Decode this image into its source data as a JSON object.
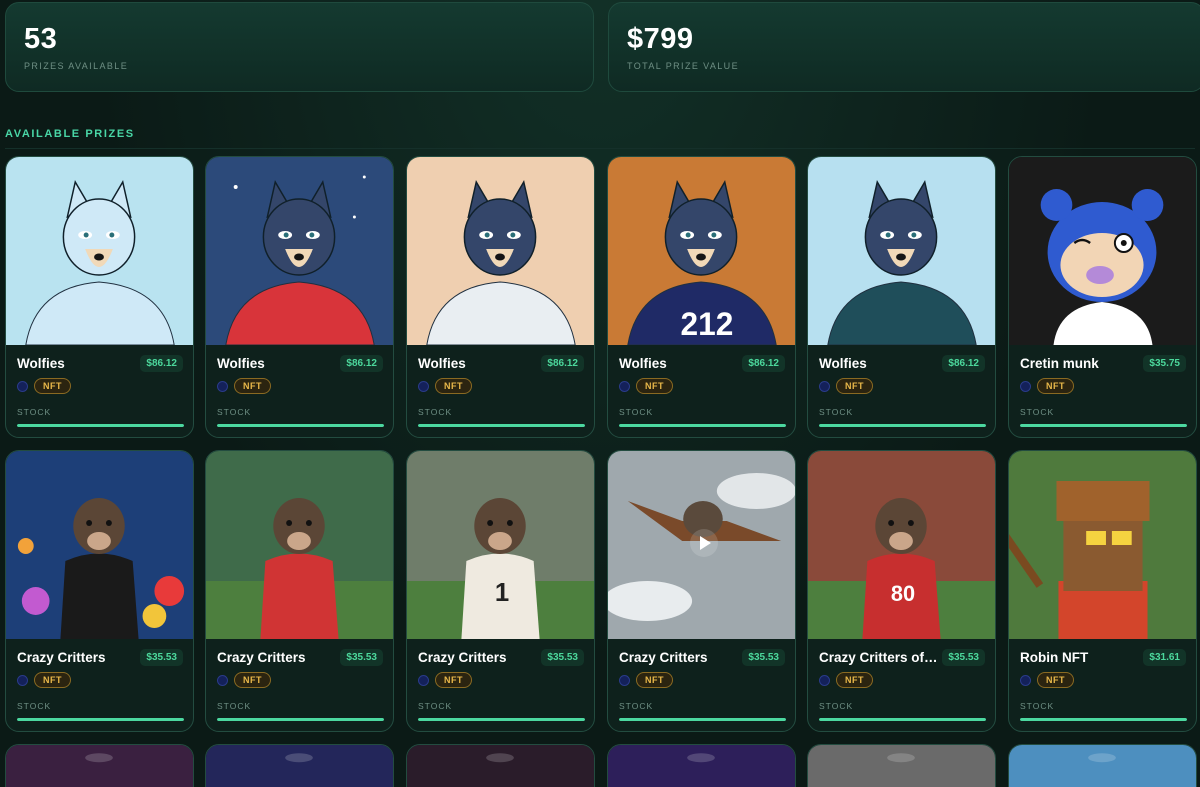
{
  "stats": [
    {
      "value": "53",
      "label": "PRIZES AVAILABLE"
    },
    {
      "value": "$799",
      "label": "TOTAL PRIZE VALUE"
    }
  ],
  "section_title": "AVAILABLE PRIZES",
  "stock_label": "STOCK",
  "badge_label": "NFT",
  "prizes": [
    {
      "name": "Wolfies",
      "price": "$86.12",
      "stock_level": 1.0,
      "image": "wolf-sketch-icon",
      "bg": "#b9e3f0"
    },
    {
      "name": "Wolfies",
      "price": "$86.12",
      "stock_level": 1.0,
      "image": "wolf-night-icon",
      "bg": "#2c4a7a"
    },
    {
      "name": "Wolfies",
      "price": "$86.12",
      "stock_level": 1.0,
      "image": "wolf-toga-icon",
      "bg": "#efcfb0"
    },
    {
      "name": "Wolfies",
      "price": "$86.12",
      "stock_level": 1.0,
      "image": "wolf-football-icon",
      "bg": "#c97a35"
    },
    {
      "name": "Wolfies",
      "price": "$86.12",
      "stock_level": 1.0,
      "image": "wolf-jacket-icon",
      "bg": "#b7e0f0"
    },
    {
      "name": "Cretin munk",
      "price": "$35.75",
      "stock_level": 1.0,
      "image": "chipmunk-icon",
      "bg": "#1b1b1b"
    },
    {
      "name": "Crazy Critters",
      "price": "$35.53",
      "stock_level": 1.0,
      "image": "mole-tuxedo-icon",
      "bg": "#1d3f78"
    },
    {
      "name": "Crazy Critters",
      "price": "$35.53",
      "stock_level": 1.0,
      "image": "mole-baseball-icon",
      "bg": "#3f6b4a"
    },
    {
      "name": "Crazy Critters",
      "price": "$35.53",
      "stock_level": 1.0,
      "image": "bear-football-icon",
      "bg": "#6f7d6a"
    },
    {
      "name": "Crazy Critters",
      "price": "$35.53",
      "stock_level": 1.0,
      "image": "skydiver-critter-icon",
      "bg": "#9fa8ad",
      "video": true
    },
    {
      "name": "Crazy Critters of C...",
      "price": "$35.53",
      "stock_level": 1.0,
      "image": "bear-football-team-icon",
      "bg": "#8a4a3a"
    },
    {
      "name": "Robin NFT",
      "price": "$31.61",
      "stock_level": 1.0,
      "image": "robin-pixel-icon",
      "bg": "#4f7a3d"
    }
  ],
  "peek": [
    {
      "image": "peek-1-icon",
      "bg": "#3a2040"
    },
    {
      "image": "peek-2-icon",
      "bg": "#23265a"
    },
    {
      "image": "peek-3-icon",
      "bg": "#2a1c2a"
    },
    {
      "image": "peek-4-icon",
      "bg": "#2d1f5a"
    },
    {
      "image": "peek-5-icon",
      "bg": "#6a6a6a"
    },
    {
      "image": "peek-6-icon",
      "bg": "#4d8fbf"
    }
  ]
}
